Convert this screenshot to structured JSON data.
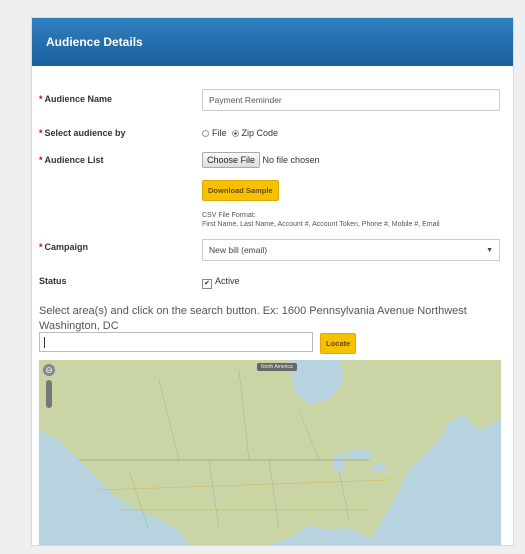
{
  "header": {
    "title": "Audience Details"
  },
  "form": {
    "audience_name": {
      "label": "Audience Name",
      "value": "Payment Reminder"
    },
    "select_by": {
      "label": "Select audience by",
      "options": [
        "File",
        "Zip Code"
      ],
      "selected": "Zip Code"
    },
    "audience_list": {
      "label": "Audience List",
      "choose_label": "Choose File",
      "file_status": "No file chosen",
      "download_label": "Download Sample",
      "csv_title": "CSV File Format:",
      "csv_fields": "First Name, Last Name, Account #, Account Token, Phone #, Mobile #, Email"
    },
    "campaign": {
      "label": "Campaign",
      "value": "New bill  (email)",
      "arrow": "▼"
    },
    "status": {
      "label": "Status",
      "checkbox_label": "Active",
      "checked": true
    },
    "required_mark": "*"
  },
  "search": {
    "instruction": "Select area(s) and click on the search button. Ex: 1600 Pennsylvania Avenue Northwest Washington, DC",
    "input_value": "",
    "locate_label": "Locate"
  },
  "map": {
    "zoom_in": "⊖",
    "region": "North America",
    "colors": {
      "water": "#b7d3df",
      "land": "#c9d5a5"
    }
  }
}
